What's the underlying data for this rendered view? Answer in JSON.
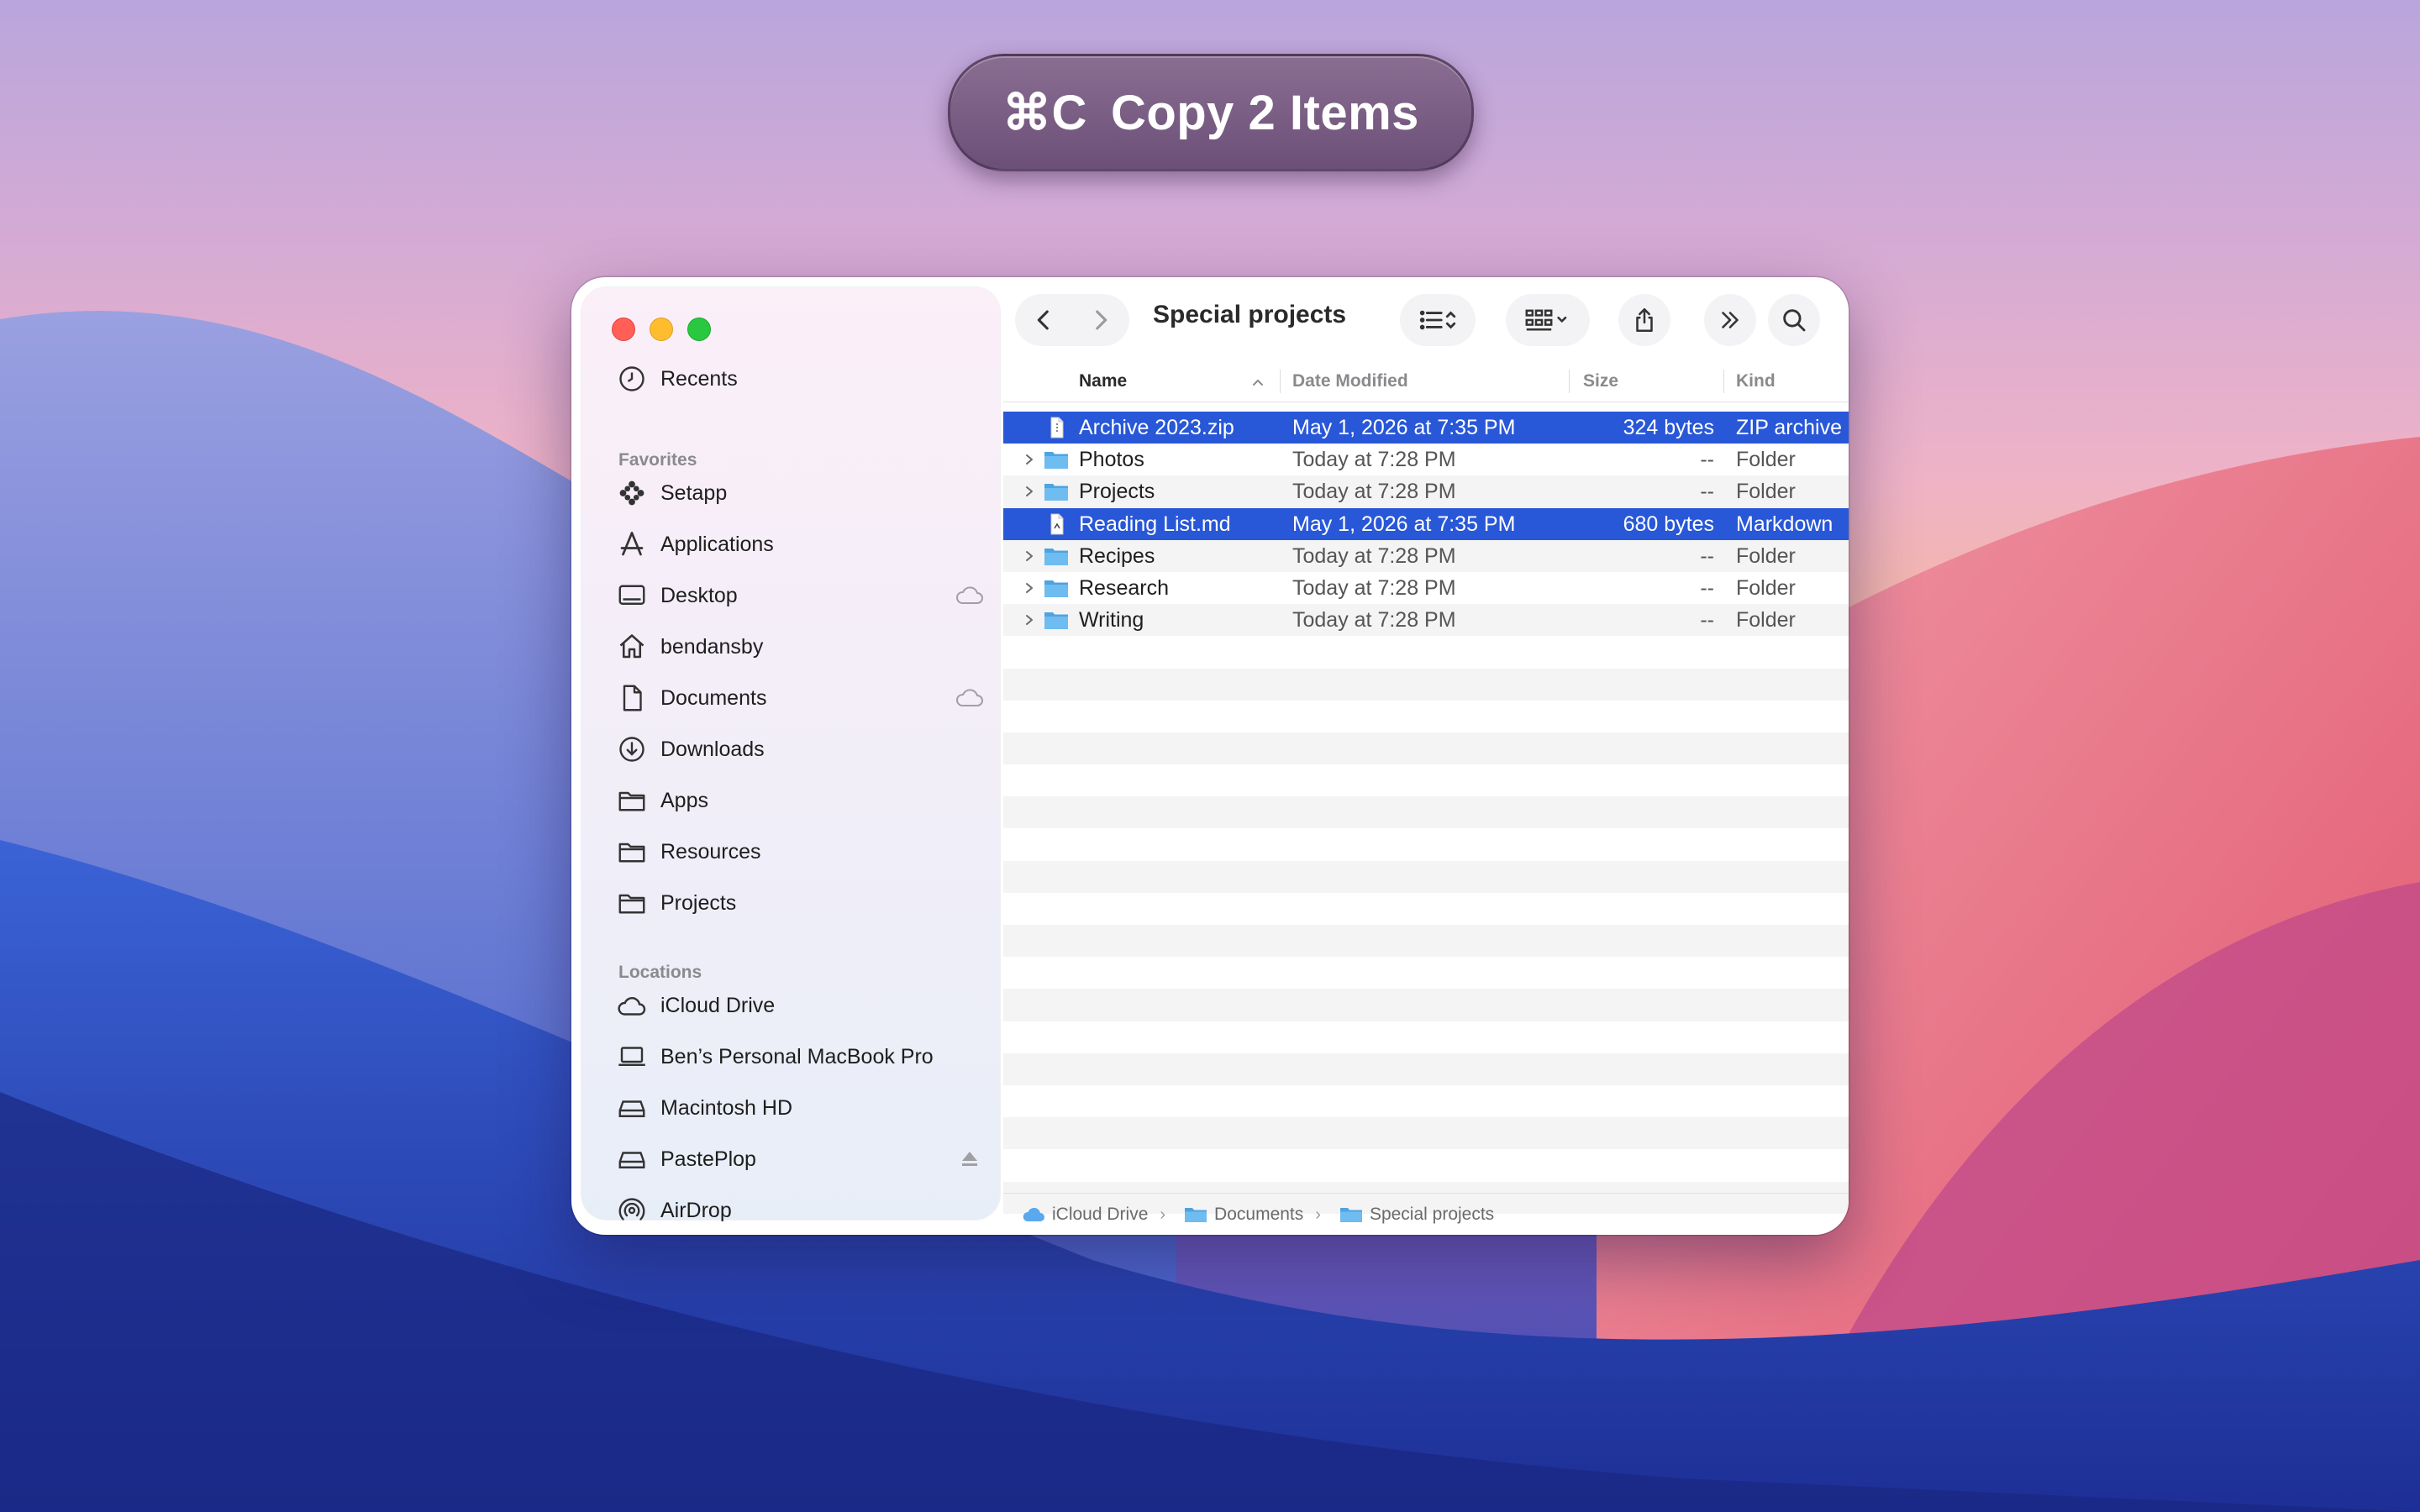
{
  "hud": {
    "shortcut": "⌘C",
    "label": "Copy 2 Items"
  },
  "window": {
    "title": "Special projects"
  },
  "sidebar": {
    "recents": "Recents",
    "favorites_heading": "Favorites",
    "favorites": [
      {
        "label": "Setapp",
        "icon": "setapp-icon"
      },
      {
        "label": "Applications",
        "icon": "applications-icon"
      },
      {
        "label": "Desktop",
        "icon": "desktop-icon",
        "trail": "cloud-icon"
      },
      {
        "label": "bendansby",
        "icon": "home-icon"
      },
      {
        "label": "Documents",
        "icon": "document-icon",
        "trail": "cloud-icon"
      },
      {
        "label": "Downloads",
        "icon": "downloads-icon"
      },
      {
        "label": "Apps",
        "icon": "folder-icon"
      },
      {
        "label": "Resources",
        "icon": "folder-icon"
      },
      {
        "label": "Projects",
        "icon": "folder-icon"
      }
    ],
    "locations_heading": "Locations",
    "locations": [
      {
        "label": "iCloud Drive",
        "icon": "icloud-icon"
      },
      {
        "label": "Ben’s Personal MacBook Pro",
        "icon": "laptop-icon"
      },
      {
        "label": "Macintosh HD",
        "icon": "disk-icon"
      },
      {
        "label": "PastePlop",
        "icon": "disk-icon",
        "trail": "eject-icon"
      },
      {
        "label": "AirDrop",
        "icon": "airdrop-icon"
      }
    ]
  },
  "columns": {
    "name": "Name",
    "date": "Date Modified",
    "size": "Size",
    "kind": "Kind"
  },
  "files": [
    {
      "name": "Archive 2023.zip",
      "date": "May 1, 2026 at 7:35 PM",
      "size": "324 bytes",
      "kind": "ZIP archive",
      "type": "file",
      "selected": true
    },
    {
      "name": "Photos",
      "date": "Today at 7:28 PM",
      "size": "--",
      "kind": "Folder",
      "type": "folder",
      "selected": false
    },
    {
      "name": "Projects",
      "date": "Today at 7:28 PM",
      "size": "--",
      "kind": "Folder",
      "type": "folder",
      "selected": false
    },
    {
      "name": "Reading List.md",
      "date": "May 1, 2026 at 7:35 PM",
      "size": "680 bytes",
      "kind": "Markdown",
      "type": "file",
      "selected": true
    },
    {
      "name": "Recipes",
      "date": "Today at 7:28 PM",
      "size": "--",
      "kind": "Folder",
      "type": "folder",
      "selected": false
    },
    {
      "name": "Research",
      "date": "Today at 7:28 PM",
      "size": "--",
      "kind": "Folder",
      "type": "folder",
      "selected": false
    },
    {
      "name": "Writing",
      "date": "Today at 7:28 PM",
      "size": "--",
      "kind": "Folder",
      "type": "folder",
      "selected": false
    }
  ],
  "path": [
    "iCloud Drive",
    "Documents",
    "Special projects"
  ],
  "colors": {
    "selection": "#2857d7",
    "folder": "#5fb2e8"
  }
}
